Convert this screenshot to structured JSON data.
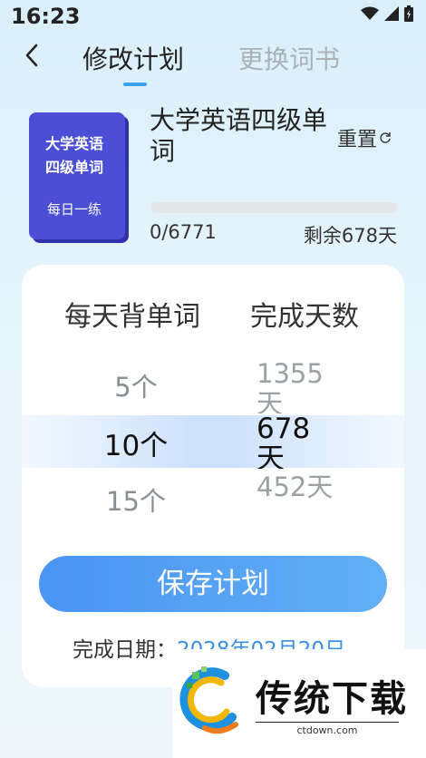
{
  "status_bar": {
    "time": "16:23"
  },
  "nav": {
    "tabs": [
      {
        "label": "修改计划",
        "active": true
      },
      {
        "label": "更换词书",
        "active": false
      }
    ]
  },
  "book": {
    "cover_title_line1": "大学英语",
    "cover_title_line2": "四级单词",
    "cover_subtitle": "每日一练",
    "name": "大学英语四级单词",
    "reset_label": "重置",
    "progress_text": "0/6771",
    "progress_fraction": 0,
    "remaining_text": "剩余678天"
  },
  "plan": {
    "col_words_header": "每天背单词",
    "col_days_header": "完成天数",
    "words_options": [
      "5个",
      "10个",
      "15个"
    ],
    "days_options": [
      "1355天",
      "678天",
      "452天"
    ],
    "selected_index": 1,
    "save_label": "保存计划",
    "finish_label": "完成日期：",
    "finish_date": "2028年02月20日"
  },
  "watermark": {
    "brand": "传统下载",
    "url": "ctdown.com"
  },
  "colors": {
    "accent": "#3aa1f0",
    "button": "#4a94f2",
    "cover": "#4b4fd6"
  }
}
